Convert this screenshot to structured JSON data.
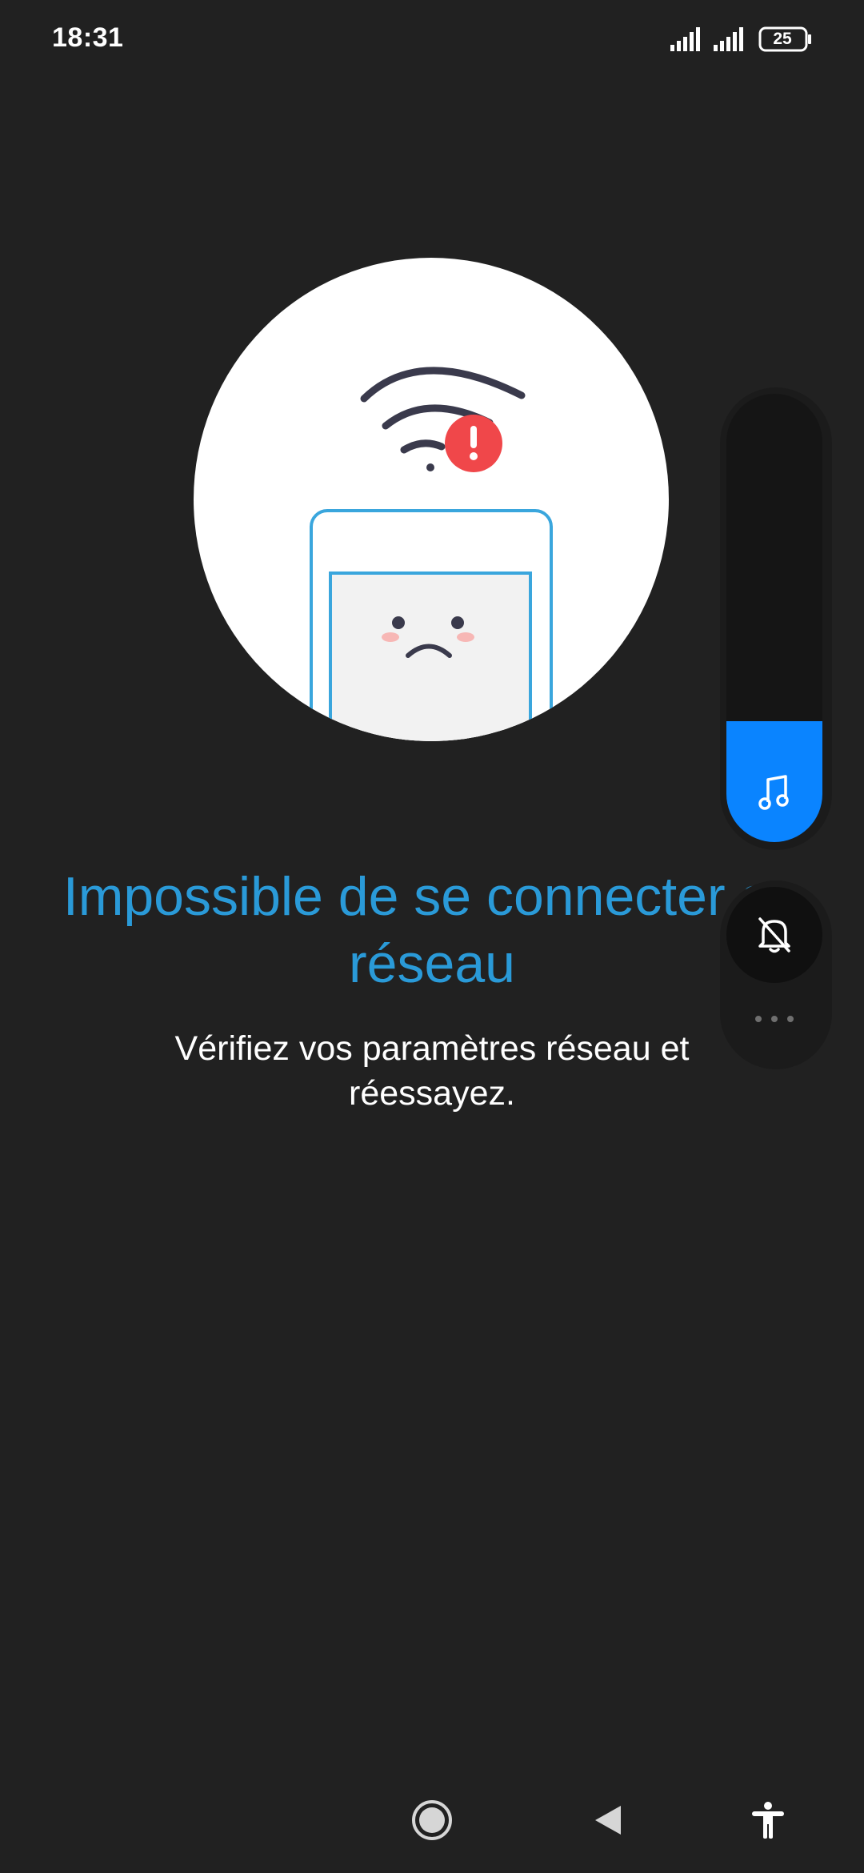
{
  "status_bar": {
    "time": "18:31",
    "battery_level": "25",
    "icons": [
      "signal-icon",
      "signal-icon",
      "battery-icon"
    ]
  },
  "illustration": {
    "icons": [
      "wifi-icon",
      "alert-badge-icon",
      "sad-phone-icon"
    ],
    "colors": {
      "circle": "#ffffff",
      "alert": "#f0474a",
      "phone_outline": "#3aa6dd"
    }
  },
  "error": {
    "title": "Impossible de se connecter au réseau",
    "message": "Vérifiez vos paramètres réseau et réessayez."
  },
  "volume_overlay": {
    "level": 0.27,
    "icons": [
      "music-note-icon",
      "bell-off-icon",
      "more-options-icon"
    ],
    "accent": "#0a84ff"
  },
  "nav_bar": {
    "icons": [
      "home-icon",
      "back-icon",
      "accessibility-icon"
    ]
  }
}
